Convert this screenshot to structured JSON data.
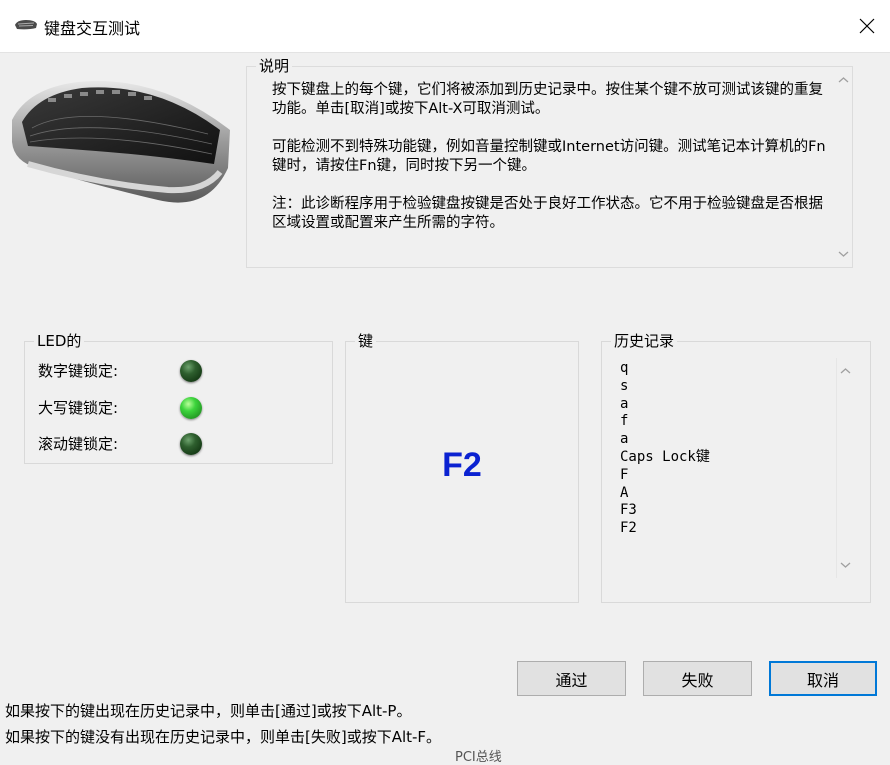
{
  "window": {
    "title": "键盘交互测试",
    "close_icon": "close-icon",
    "title_icon": "keyboard-icon"
  },
  "description": {
    "label": "说明",
    "paragraphs": [
      "按下键盘上的每个键，它们将被添加到历史记录中。按住某个键不放可测试该键的重复功能。单击[取消]或按下Alt-X可取消测试。",
      "可能检测不到特殊功能键，例如音量控制键或Internet访问键。测试笔记本计算机的Fn键时，请按住Fn键，同时按下另一个键。",
      "注：此诊断程序用于检验键盘按键是否处于良好工作状态。它不用于检验键盘是否根据区域设置或配置来产生所需的字符。"
    ]
  },
  "led": {
    "label": "LED的",
    "items": [
      {
        "label": "数字键锁定:",
        "state": "off"
      },
      {
        "label": "大写键锁定:",
        "state": "on"
      },
      {
        "label": "滚动键锁定:",
        "state": "off"
      }
    ]
  },
  "key": {
    "label": "键",
    "current": "F2",
    "color": "#0b22d1"
  },
  "history": {
    "label": "历史记录",
    "items": [
      "q",
      "s",
      "a",
      "f",
      "a",
      "Caps Lock键",
      "F",
      "A",
      "F3",
      "F2"
    ]
  },
  "buttons": {
    "pass": "通过",
    "fail": "失败",
    "cancel": "取消"
  },
  "hints": {
    "pass_hint": "如果按下的键出现在历史记录中，则单击[通过]或按下Alt-P。",
    "fail_hint": "如果按下的键没有出现在历史记录中，则单击[失败]或按下Alt-F。"
  },
  "background_fragment": "PCI总线",
  "colors": {
    "accent": "#0078d7",
    "led_on": "#3cd43c",
    "led_off": "#2e5f2e"
  }
}
